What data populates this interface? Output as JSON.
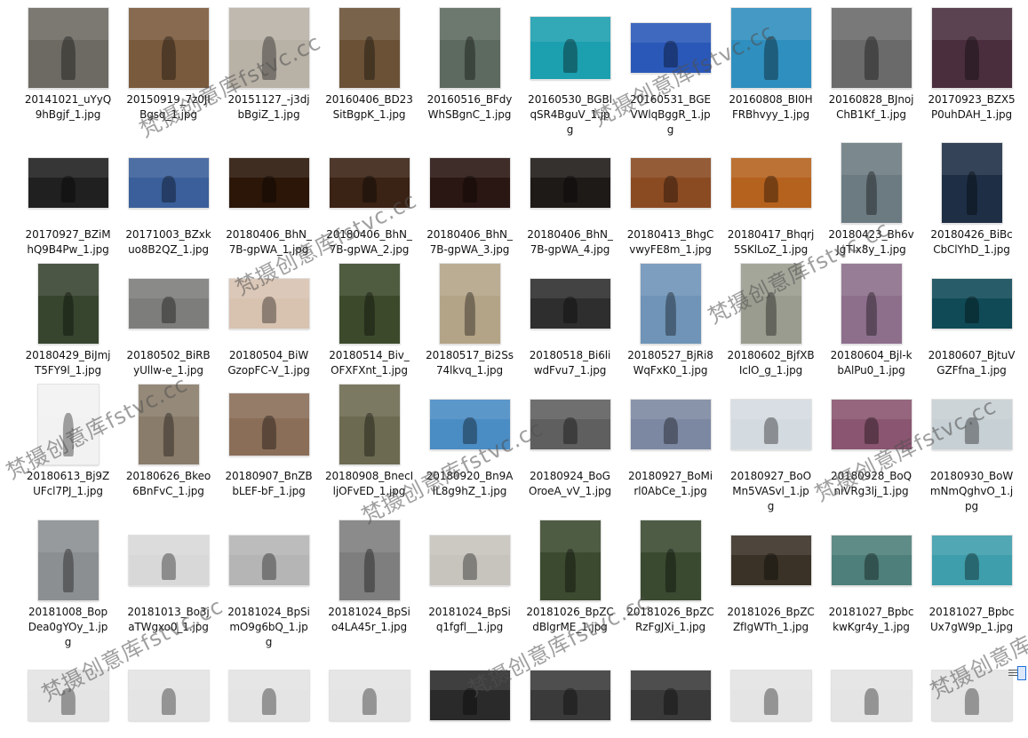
{
  "view": "large-icons",
  "rows": [
    [
      {
        "name": "20141021_uYyQ\n9hBgjf_1.jpg",
        "c": "#6d6a63",
        "ori": "l"
      },
      {
        "name": "20150919_7z0JI\nBgsq_1.jpg",
        "c": "#7a5a3c",
        "ori": "l"
      },
      {
        "name": "20151127_-j3dj\nbBgiZ_1.jpg",
        "c": "#b8b1a6",
        "ori": "l"
      },
      {
        "name": "20160406_BD23\nSitBgpK_1.jpg",
        "c": "#6b5237",
        "ori": "p"
      },
      {
        "name": "20160516_BFdy\nWhSBgnC_1.jpg",
        "c": "#5d6a5f",
        "ori": "p"
      },
      {
        "name": "20160530_BGBl\nqSR4BguV_1.jp\ng",
        "c": "#1c9fae",
        "ori": "s"
      },
      {
        "name": "20160531_BGE\nVWlqBggR_1.jp\ng",
        "c": "#2a58b8",
        "ori": "w"
      },
      {
        "name": "20160808_BI0H\nFRBhvyy_1.jpg",
        "c": "#2f8fbf",
        "ori": "l"
      },
      {
        "name": "20160828_BJnoj\nChB1Kf_1.jpg",
        "c": "#6a6a6a",
        "ori": "l"
      },
      {
        "name": "20170923_BZX5\nP0uhDAH_1.jpg",
        "c": "#4a2e3e",
        "ori": "l"
      }
    ],
    [
      {
        "name": "20170927_BZiM\nhQ9B4Pw_1.jpg",
        "c": "#202020",
        "ori": "w"
      },
      {
        "name": "20171003_BZxk\nuo8B2QZ_1.jpg",
        "c": "#3a5f9a",
        "ori": "w"
      },
      {
        "name": "20180406_BhN_\n7B-gpWA_1.jpg",
        "c": "#2b1608",
        "ori": "w"
      },
      {
        "name": "20180406_BhN_\n7B-gpWA_2.jpg",
        "c": "#3a2214",
        "ori": "w"
      },
      {
        "name": "20180406_BhN_\n7B-gpWA_3.jpg",
        "c": "#2a1612",
        "ori": "w"
      },
      {
        "name": "20180406_BhN_\n7B-gpWA_4.jpg",
        "c": "#1e1a18",
        "ori": "w"
      },
      {
        "name": "20180413_BhgC\nvwyFE8m_1.jpg",
        "c": "#8a4a22",
        "ori": "w"
      },
      {
        "name": "20180417_Bhqrj\n5SKlLoZ_1.jpg",
        "c": "#b5621e",
        "ori": "w"
      },
      {
        "name": "20180423_Bh6v\nJgTlx8y_1.jpg",
        "c": "#6c7b82",
        "ori": "p"
      },
      {
        "name": "20180426_BiBc\nCbClYhD_1.jpg",
        "c": "#1e2e45",
        "ori": "p"
      }
    ],
    [
      {
        "name": "20180429_BiJmj\nT5FY9l_1.jpg",
        "c": "#37452f",
        "ori": "p"
      },
      {
        "name": "20180502_BiRB\nyUllw-e_1.jpg",
        "c": "#7d7e7c",
        "ori": "w"
      },
      {
        "name": "20180504_BiW\nGzopFC-V_1.jpg",
        "c": "#d8c2b0",
        "ori": "w"
      },
      {
        "name": "20180514_Biv_\nOFXFXnt_1.jpg",
        "c": "#3c4a2b",
        "ori": "p"
      },
      {
        "name": "20180517_Bi2Ss\n74lkvq_1.jpg",
        "c": "#b4a487",
        "ori": "p"
      },
      {
        "name": "20180518_Bi6li\nwdFvu7_1.jpg",
        "c": "#2e2e2e",
        "ori": "w"
      },
      {
        "name": "20180527_BjRi8\nWqFxK0_1.jpg",
        "c": "#6f94b7",
        "ori": "p"
      },
      {
        "name": "20180602_BjfXB\nIclO_g_1.jpg",
        "c": "#9a9c8f",
        "ori": "p"
      },
      {
        "name": "20180604_Bjl-k\nbAlPu0_1.jpg",
        "c": "#8d6f8c",
        "ori": "p"
      },
      {
        "name": "20180607_BjtuV\nGZFfna_1.jpg",
        "c": "#104a57",
        "ori": "w"
      }
    ],
    [
      {
        "name": "20180613_Bj9Z\nUFcl7PJ_1.jpg",
        "c": "#f2f2f2",
        "ori": "p"
      },
      {
        "name": "20180626_Bkeo\n6BnFvC_1.jpg",
        "c": "#8a7c6a",
        "ori": "p"
      },
      {
        "name": "20180907_BnZB\nbLEF-bF_1.jpg",
        "c": "#8a6e58",
        "ori": "s"
      },
      {
        "name": "20180908_BnecI\nljOFvED_1.jpg",
        "c": "#6c6a50",
        "ori": "p"
      },
      {
        "name": "20180920_Bn9A\nIL8g9hZ_1.jpg",
        "c": "#4a8cc4",
        "ori": "w"
      },
      {
        "name": "20180924_BoG\nOroeA_vV_1.jpg",
        "c": "#5f5f5f",
        "ori": "w"
      },
      {
        "name": "20180927_BoMi\nrl0AbCe_1.jpg",
        "c": "#7c88a2",
        "ori": "w"
      },
      {
        "name": "20180927_BoO\nMn5VASvl_1.jp\ng",
        "c": "#d4dbe0",
        "ori": "w"
      },
      {
        "name": "20180928_BoQ\nniVRg3lj_1.jpg",
        "c": "#8a5570",
        "ori": "w"
      },
      {
        "name": "20180930_BoW\nmNmQghvO_1.j\npg",
        "c": "#c7d0d4",
        "ori": "w"
      }
    ],
    [
      {
        "name": "20181008_Bop\nDea0gYOy_1.jp\ng",
        "c": "#8c8f92",
        "ori": "p"
      },
      {
        "name": "20181013_Bo3j\naTWgxo0_1.jpg",
        "c": "#d8d8d8",
        "ori": "w"
      },
      {
        "name": "20181024_BpSi\nmO9g6bQ_1.jp\ng",
        "c": "#b5b5b5",
        "ori": "w"
      },
      {
        "name": "20181024_BpSi\no4LA45r_1.jpg",
        "c": "#7e7e7e",
        "ori": "p"
      },
      {
        "name": "20181024_BpSi\nq1fgfl__1.jpg",
        "c": "#c7c3bd",
        "ori": "w"
      },
      {
        "name": "20181026_BpZC\ndBlgrME_1.jpg",
        "c": "#3c4a2f",
        "ori": "p"
      },
      {
        "name": "20181026_BpZC\nRzFgJXi_1.jpg",
        "c": "#3a4a30",
        "ori": "p"
      },
      {
        "name": "20181026_BpZC\nZfIgWTh_1.jpg",
        "c": "#3a3226",
        "ori": "w"
      },
      {
        "name": "20181027_Bpbc\nkwKgr4y_1.jpg",
        "c": "#4e7f7a",
        "ori": "w"
      },
      {
        "name": "20181027_Bpbc\nUx7gW9p_1.jpg",
        "c": "#3e9eab",
        "ori": "w"
      }
    ],
    [
      {
        "name": "",
        "c": "#e4e4e4",
        "ori": "w"
      },
      {
        "name": "",
        "c": "#e4e4e4",
        "ori": "w"
      },
      {
        "name": "",
        "c": "#e4e4e4",
        "ori": "w"
      },
      {
        "name": "",
        "c": "#e4e4e4",
        "ori": "w"
      },
      {
        "name": "",
        "c": "#2a2a2a",
        "ori": "w"
      },
      {
        "name": "",
        "c": "#3a3a3a",
        "ori": "w"
      },
      {
        "name": "",
        "c": "#3a3a3a",
        "ori": "w"
      },
      {
        "name": "",
        "c": "#e4e4e4",
        "ori": "w"
      },
      {
        "name": "",
        "c": "#e4e4e4",
        "ori": "w"
      },
      {
        "name": "",
        "c": "#e4e4e4",
        "ori": "w"
      }
    ]
  ],
  "watermarks": [
    "梵摄创意库fstvc.cc",
    "梵摄创意库fstvc.cc",
    "梵摄创意库fstvc.cc",
    "梵摄创意库fstvc.cc",
    "梵摄创意库fstvc.cc",
    "梵摄创意库fstvc.cc",
    "梵摄创意库fstvc.cc",
    "梵摄创意库fstvc.cc",
    "梵摄创意库fstvc.cc",
    "梵摄创意库fstvc.cc"
  ]
}
